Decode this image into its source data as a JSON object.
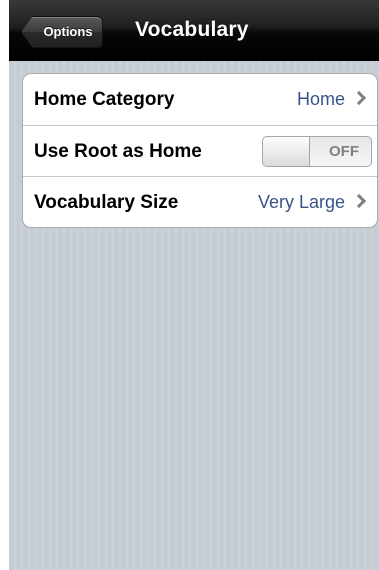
{
  "navbar": {
    "back_label": "Options",
    "title": "Vocabulary"
  },
  "settings": {
    "rows": [
      {
        "label": "Home Category",
        "value": "Home"
      },
      {
        "label": "Use Root as Home",
        "toggle_state": "OFF"
      },
      {
        "label": "Vocabulary Size",
        "value": "Very Large"
      }
    ]
  }
}
